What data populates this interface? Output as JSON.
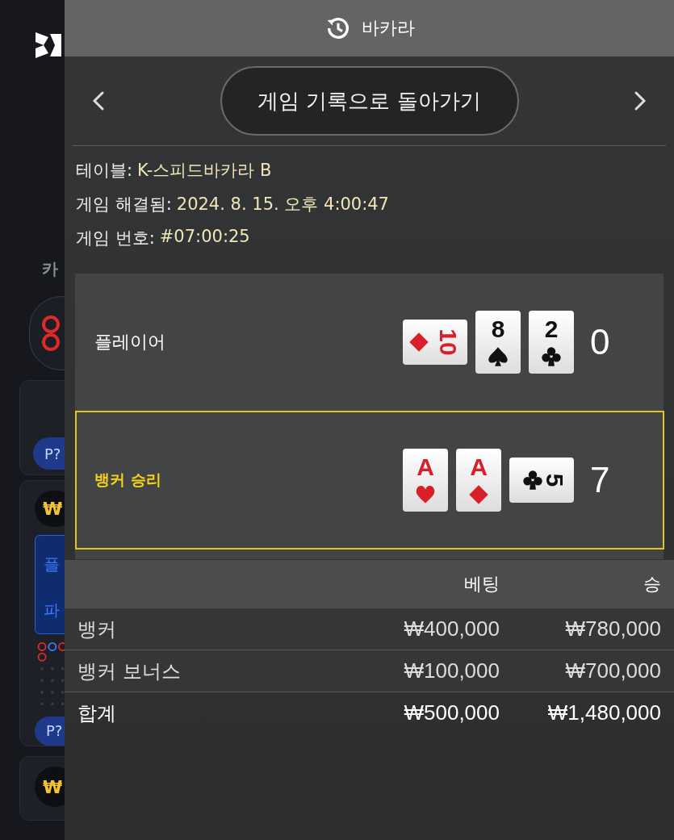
{
  "background": {
    "side_label": "카",
    "badges": [
      "P?",
      "P?"
    ],
    "currency_marks": [
      "₩",
      "₩"
    ],
    "blue_card": {
      "lines": [
        "플",
        "파"
      ]
    }
  },
  "header": {
    "title": "바카라"
  },
  "nav": {
    "back_button": "게임 기록으로 돌아가기"
  },
  "info": [
    {
      "label": "테이블:",
      "value": "K-스피드바카라 B"
    },
    {
      "label": "게임 해결됨:",
      "value": "2024. 8. 15. 오후 4:00:47"
    },
    {
      "label": "게임 번호:",
      "value": "#07:00:25"
    }
  ],
  "hands": [
    {
      "label": "플레이어",
      "winner": false,
      "score": "0",
      "cards": [
        {
          "rank": "10",
          "kind": "diamond",
          "rotated": true
        },
        {
          "rank": "8",
          "kind": "spade",
          "rotated": false
        },
        {
          "rank": "2",
          "kind": "club",
          "rotated": false
        }
      ]
    },
    {
      "label": "뱅커 승리",
      "winner": true,
      "score": "7",
      "cards": [
        {
          "rank": "A",
          "kind": "heart",
          "rotated": false
        },
        {
          "rank": "A",
          "kind": "diamond",
          "rotated": false
        },
        {
          "rank": "5",
          "kind": "club",
          "rotated": true
        }
      ]
    }
  ],
  "bets": {
    "columns": [
      "베팅",
      "승"
    ],
    "rows": [
      {
        "name": "뱅커",
        "bet": "₩400,000",
        "win": "₩780,000",
        "total": false
      },
      {
        "name": "뱅커 보너스",
        "bet": "₩100,000",
        "win": "₩700,000",
        "total": false
      },
      {
        "name": "합계",
        "bet": "₩500,000",
        "win": "₩1,480,000",
        "total": true
      }
    ]
  }
}
